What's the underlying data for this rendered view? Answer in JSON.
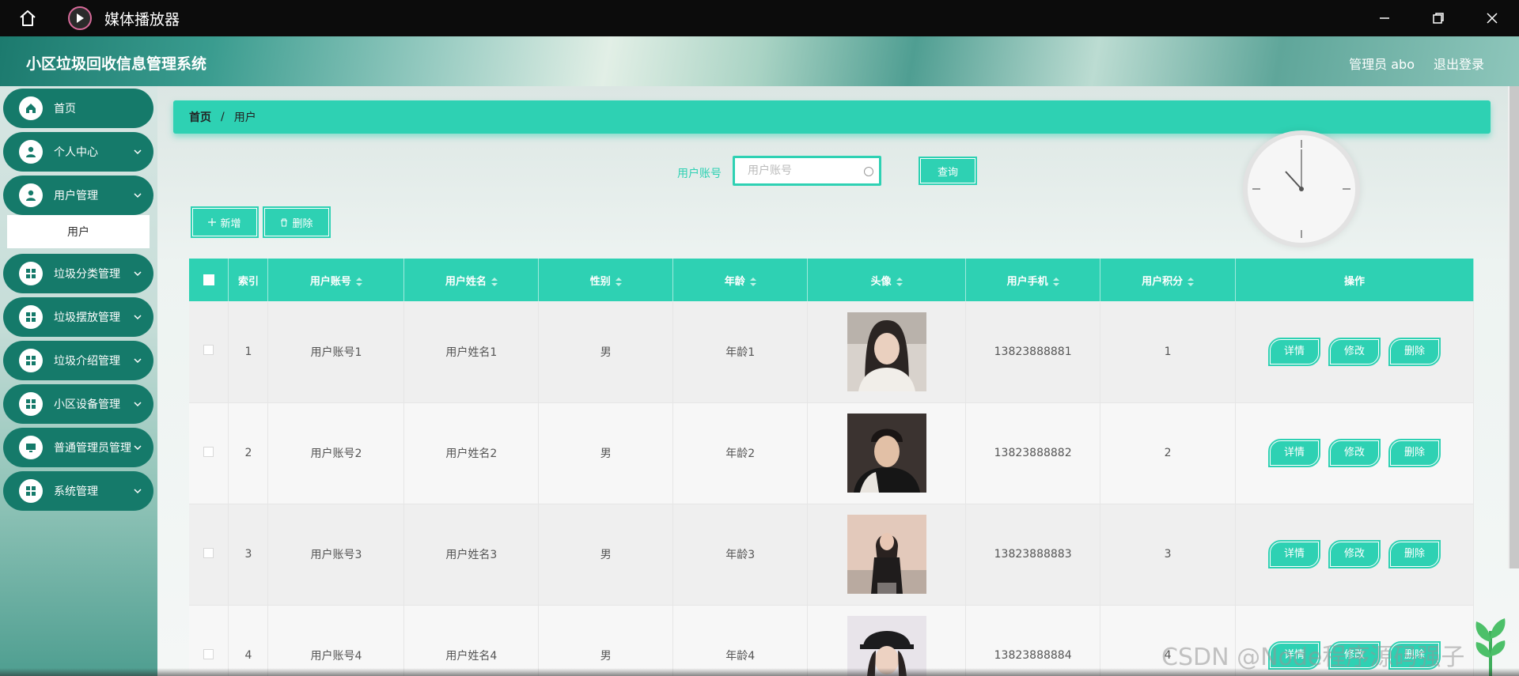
{
  "window": {
    "title": "媒体播放器",
    "icons": {
      "home": "home-icon",
      "app": "play-icon",
      "minimize": "minimize-icon",
      "maximize": "maximize-icon",
      "close": "close-icon"
    }
  },
  "header": {
    "app_title": "小区垃圾回收信息管理系统",
    "user_label": "管理员 abo",
    "logout_label": "退出登录"
  },
  "sidebar": {
    "items": [
      {
        "label": "首页",
        "icon": "home-icon"
      },
      {
        "label": "个人中心",
        "icon": "user-icon"
      },
      {
        "label": "用户管理",
        "icon": "user-icon"
      },
      {
        "label": "垃圾分类管理",
        "icon": "grid-icon"
      },
      {
        "label": "垃圾摆放管理",
        "icon": "grid-icon"
      },
      {
        "label": "垃圾介绍管理",
        "icon": "grid-icon"
      },
      {
        "label": "小区设备管理",
        "icon": "grid-icon"
      },
      {
        "label": "普通管理员管理",
        "icon": "monitor-icon"
      },
      {
        "label": "系统管理",
        "icon": "grid-icon"
      }
    ],
    "submenu": {
      "label": "用户"
    }
  },
  "breadcrumb": {
    "home": "首页",
    "separator": "/",
    "current": "用户"
  },
  "search": {
    "label": "用户账号",
    "placeholder": "用户账号",
    "button": "查询"
  },
  "toolbar": {
    "add": "新增",
    "delete": "删除",
    "add_icon": "plus-icon",
    "delete_icon": "trash-icon"
  },
  "table": {
    "headers": [
      "索引",
      "用户账号",
      "用户姓名",
      "性别",
      "年龄",
      "头像",
      "用户手机",
      "用户积分",
      "操作"
    ],
    "rows": [
      {
        "index": "1",
        "account": "用户账号1",
        "name": "用户姓名1",
        "gender": "男",
        "age": "年龄1",
        "phone": "13823888881",
        "points": "1"
      },
      {
        "index": "2",
        "account": "用户账号2",
        "name": "用户姓名2",
        "gender": "男",
        "age": "年龄2",
        "phone": "13823888882",
        "points": "2"
      },
      {
        "index": "3",
        "account": "用户账号3",
        "name": "用户姓名3",
        "gender": "男",
        "age": "年龄3",
        "phone": "13823888883",
        "points": "3"
      },
      {
        "index": "4",
        "account": "用户账号4",
        "name": "用户姓名4",
        "gender": "男",
        "age": "年龄4",
        "phone": "13823888884",
        "points": "4"
      }
    ],
    "actions": {
      "detail": "详情",
      "edit": "修改",
      "delete": "删除"
    }
  },
  "watermark": "CSDN @Node程序源码强子",
  "colors": {
    "accent": "#2ed1b3",
    "sidebar_item": "#157a6a",
    "titlebar": "#0c0c0c"
  }
}
